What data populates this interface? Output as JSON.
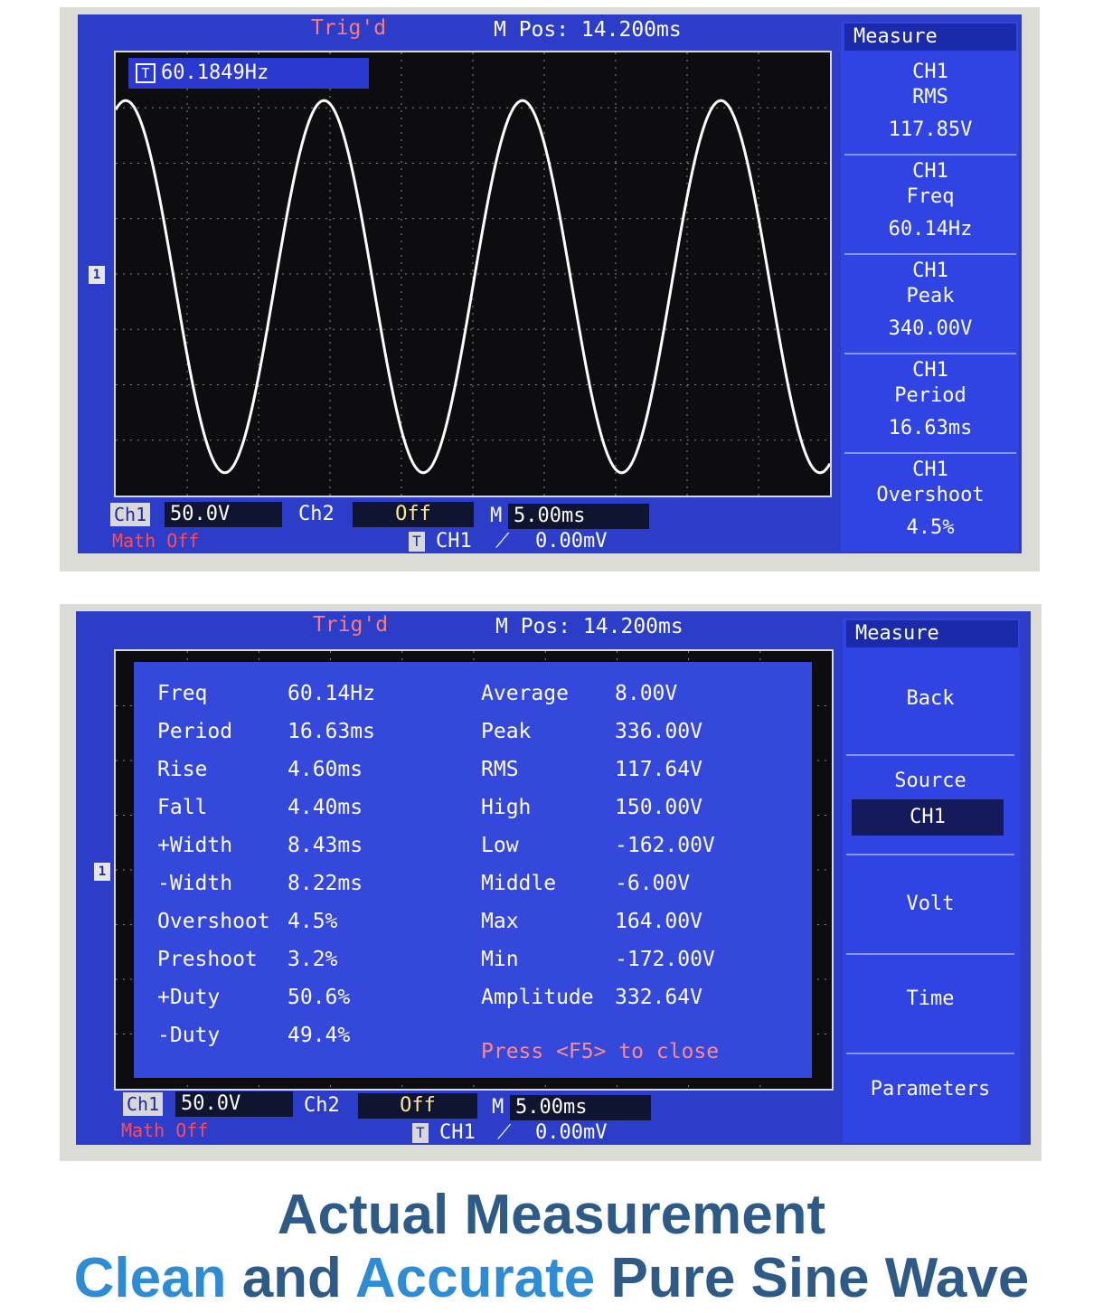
{
  "screen1": {
    "trig": "Trig'd",
    "mpos": "M Pos: 14.200ms",
    "freq_readout": "60.1849Hz",
    "side_title": "Measure",
    "cells": [
      {
        "ch": "CH1",
        "name": "RMS",
        "value": "117.85V"
      },
      {
        "ch": "CH1",
        "name": "Freq",
        "value": "60.14Hz"
      },
      {
        "ch": "CH1",
        "name": "Peak",
        "value": "340.00V"
      },
      {
        "ch": "CH1",
        "name": "Period",
        "value": "16.63ms"
      },
      {
        "ch": "CH1",
        "name": "Overshoot",
        "value": "4.5%"
      }
    ],
    "ch1_label": "Ch1",
    "ch1_value": "50.0V",
    "ch2_label": "Ch2",
    "ch2_value": "Off",
    "m_label": "M",
    "m_value": "5.00ms",
    "math": "Math Off",
    "trigger_channel": "CH1",
    "trigger_level": "0.00mV",
    "marker": "1",
    "t_icon": "T"
  },
  "screen2": {
    "trig": "Trig'd",
    "mpos": "M Pos: 14.200ms",
    "side_title": "Measure",
    "left_params": [
      {
        "name": "Freq",
        "value": "60.14Hz"
      },
      {
        "name": "Period",
        "value": "16.63ms"
      },
      {
        "name": "Rise",
        "value": "4.60ms"
      },
      {
        "name": "Fall",
        "value": "4.40ms"
      },
      {
        "name": "+Width",
        "value": "8.43ms"
      },
      {
        "name": "-Width",
        "value": "8.22ms"
      },
      {
        "name": "Overshoot",
        "value": "4.5%"
      },
      {
        "name": "Preshoot",
        "value": "3.2%"
      },
      {
        "name": "+Duty",
        "value": "50.6%"
      },
      {
        "name": "-Duty",
        "value": "49.4%"
      }
    ],
    "right_params": [
      {
        "name": "Average",
        "value": "8.00V"
      },
      {
        "name": "Peak",
        "value": "336.00V"
      },
      {
        "name": "RMS",
        "value": "117.64V"
      },
      {
        "name": "High",
        "value": "150.00V"
      },
      {
        "name": "Low",
        "value": "-162.00V"
      },
      {
        "name": "Middle",
        "value": "-6.00V"
      },
      {
        "name": "Max",
        "value": "164.00V"
      },
      {
        "name": "Min",
        "value": "-172.00V"
      },
      {
        "name": "Amplitude",
        "value": "332.64V"
      }
    ],
    "press_note": "Press <F5> to close",
    "buttons": {
      "back": "Back",
      "source": "Source",
      "source_value": "CH1",
      "volt": "Volt",
      "time": "Time",
      "parameters": "Parameters"
    },
    "ch1_label": "Ch1",
    "ch1_value": "50.0V",
    "ch2_label": "Ch2",
    "ch2_value": "Off",
    "m_label": "M",
    "m_value": "5.00ms",
    "math": "Math Off",
    "trigger_channel": "CH1",
    "trigger_level": "0.00mV",
    "marker": "1",
    "t_icon": "T"
  },
  "caption": {
    "line1": "Actual Measurement",
    "line2_part1": "Clean",
    "line2_part2": "and",
    "line2_part3": "Accurate",
    "line2_part4": "Pure Sine Wave"
  },
  "colors": {
    "screen_blue": "#2c3ec9",
    "trace": "#ffffff",
    "caption_dark": "#2d5a86",
    "caption_light": "#2e8bd6"
  }
}
